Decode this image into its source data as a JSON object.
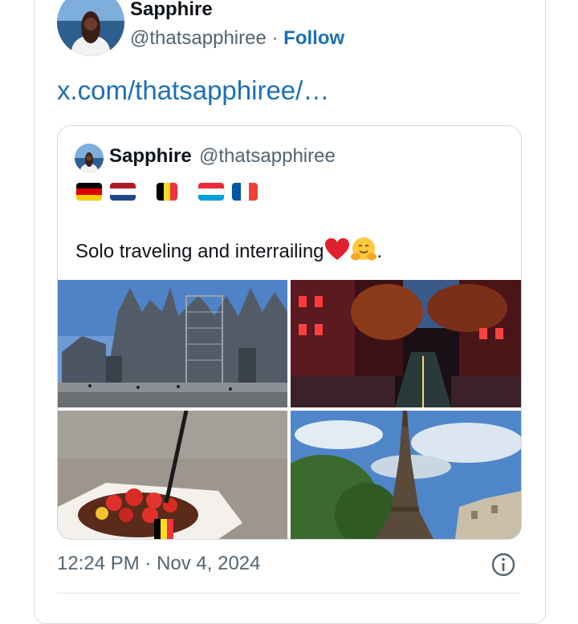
{
  "author": {
    "name": "Sapphire",
    "handle": "@thatsapphiree",
    "separator": "·",
    "follow_label": "Follow"
  },
  "link_text": "x.com/thatsapphiree/…",
  "quoted": {
    "name": "Sapphire",
    "handle": "@thatsapphiree",
    "flags": [
      "germany-flag-icon",
      "netherlands-flag-icon",
      "belgium-flag-icon",
      "luxembourg-flag-icon",
      "france-flag-icon"
    ],
    "text": "Solo traveling and interrailing",
    "text_end": ".",
    "emojis": [
      "red-heart-icon",
      "hugging-face-icon"
    ],
    "photos": [
      "cologne-cathedral-photo",
      "red-canal-street-photo",
      "chocolate-strawberry-waffle-photo",
      "eiffel-tower-photo"
    ]
  },
  "timestamp": {
    "time": "12:24 PM",
    "separator": "·",
    "date": "Nov 4, 2024"
  },
  "colors": {
    "link_blue": "#1d6fb5",
    "secondary_text": "#536471",
    "border": "#cfd9de"
  }
}
